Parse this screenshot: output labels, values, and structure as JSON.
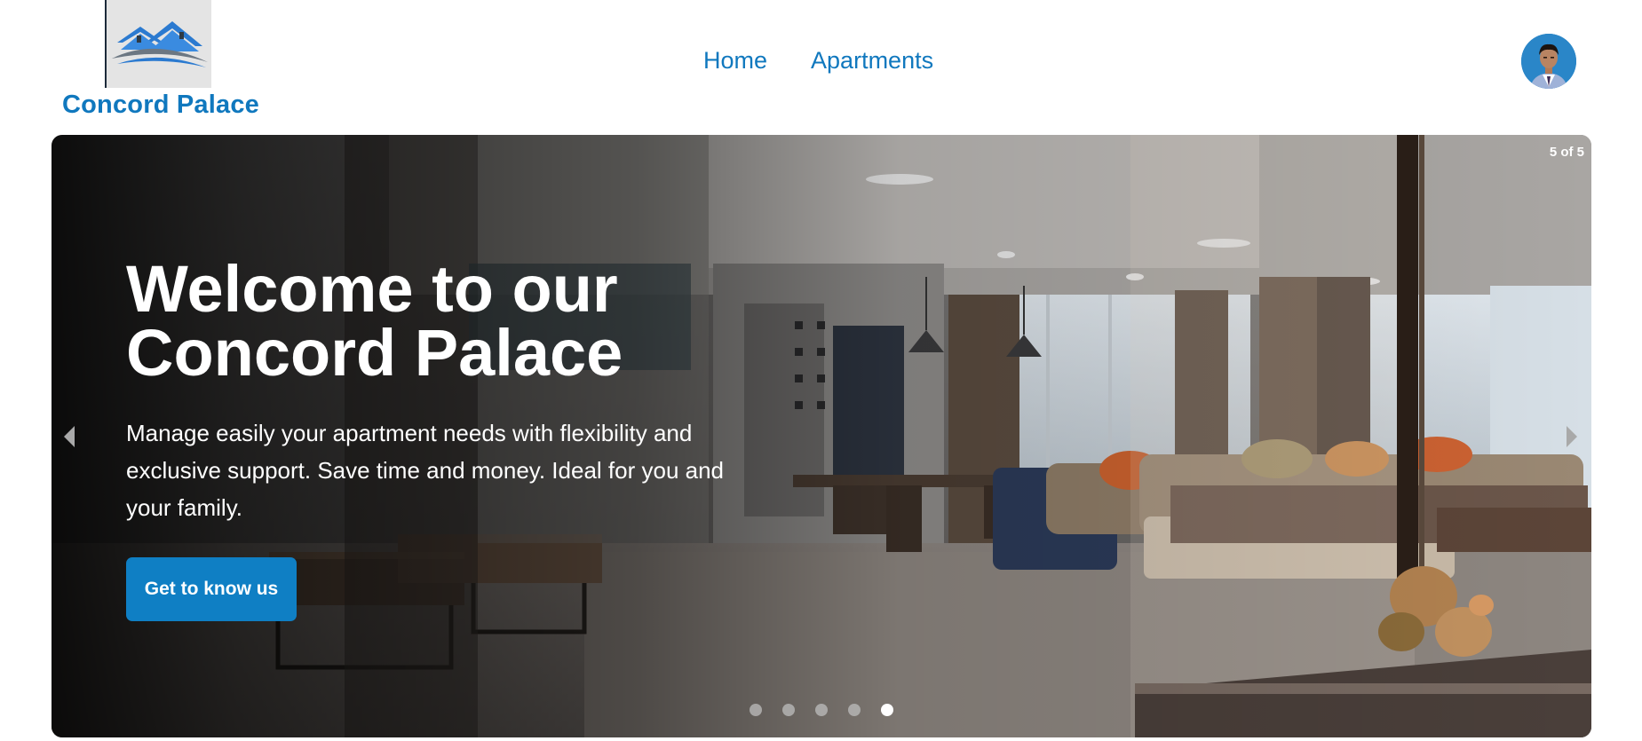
{
  "header": {
    "brand": "Concord Palace",
    "nav": [
      {
        "label": "Home"
      },
      {
        "label": "Apartments"
      }
    ]
  },
  "carousel": {
    "counter": "5 of 5",
    "title": "Welcome to our Concord Palace",
    "description": "Manage easily your apartment needs with flexibility and exclusive support. Save time and money. Ideal for you and your family.",
    "cta_label": "Get to know us",
    "slide_count": 5,
    "active_slide": 5
  },
  "colors": {
    "brand": "#1078be",
    "button": "#0f7fc4"
  }
}
